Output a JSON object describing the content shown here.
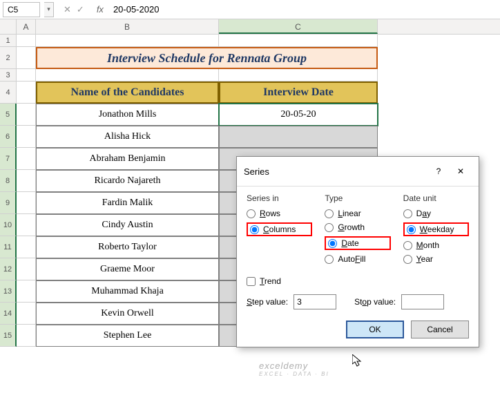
{
  "nameBox": "C5",
  "formulaBar": "20-05-2020",
  "columns": [
    "A",
    "B",
    "C"
  ],
  "rowNums": [
    "1",
    "2",
    "3",
    "4",
    "5",
    "6",
    "7",
    "8",
    "9",
    "10",
    "11",
    "12",
    "13",
    "14",
    "15"
  ],
  "title": "Interview Schedule for Rennata Group",
  "headers": {
    "b": "Name of the Candidates",
    "c": "Interview Date"
  },
  "candidates": [
    "Jonathon Mills",
    "Alisha Hick",
    "Abraham Benjamin",
    "Ricardo Najareth",
    "Fardin Malik",
    "Cindy Austin",
    "Roberto Taylor",
    "Graeme Moor",
    "Muhammad Khaja",
    "Kevin Orwell",
    "Stephen Lee"
  ],
  "dateValue": "20-05-20",
  "dialog": {
    "title": "Series",
    "seriesInLabel": "Series in",
    "typeLabel": "Type",
    "dateUnitLabel": "Date unit",
    "rows": "Rows",
    "columns": "Columns",
    "linear": "Linear",
    "growth": "Growth",
    "date": "Date",
    "autofill": "AutoFill",
    "day": "Day",
    "weekday": "Weekday",
    "month": "Month",
    "year": "Year",
    "trend": "Trend",
    "stepLabel": "Step value:",
    "stepValue": "3",
    "stopLabel": "Stop value:",
    "stopValue": "",
    "ok": "OK",
    "cancel": "Cancel",
    "help": "?",
    "close": "✕"
  },
  "watermark": {
    "main": "exceldemy",
    "sub": "EXCEL · DATA · BI"
  },
  "fx": "fx"
}
